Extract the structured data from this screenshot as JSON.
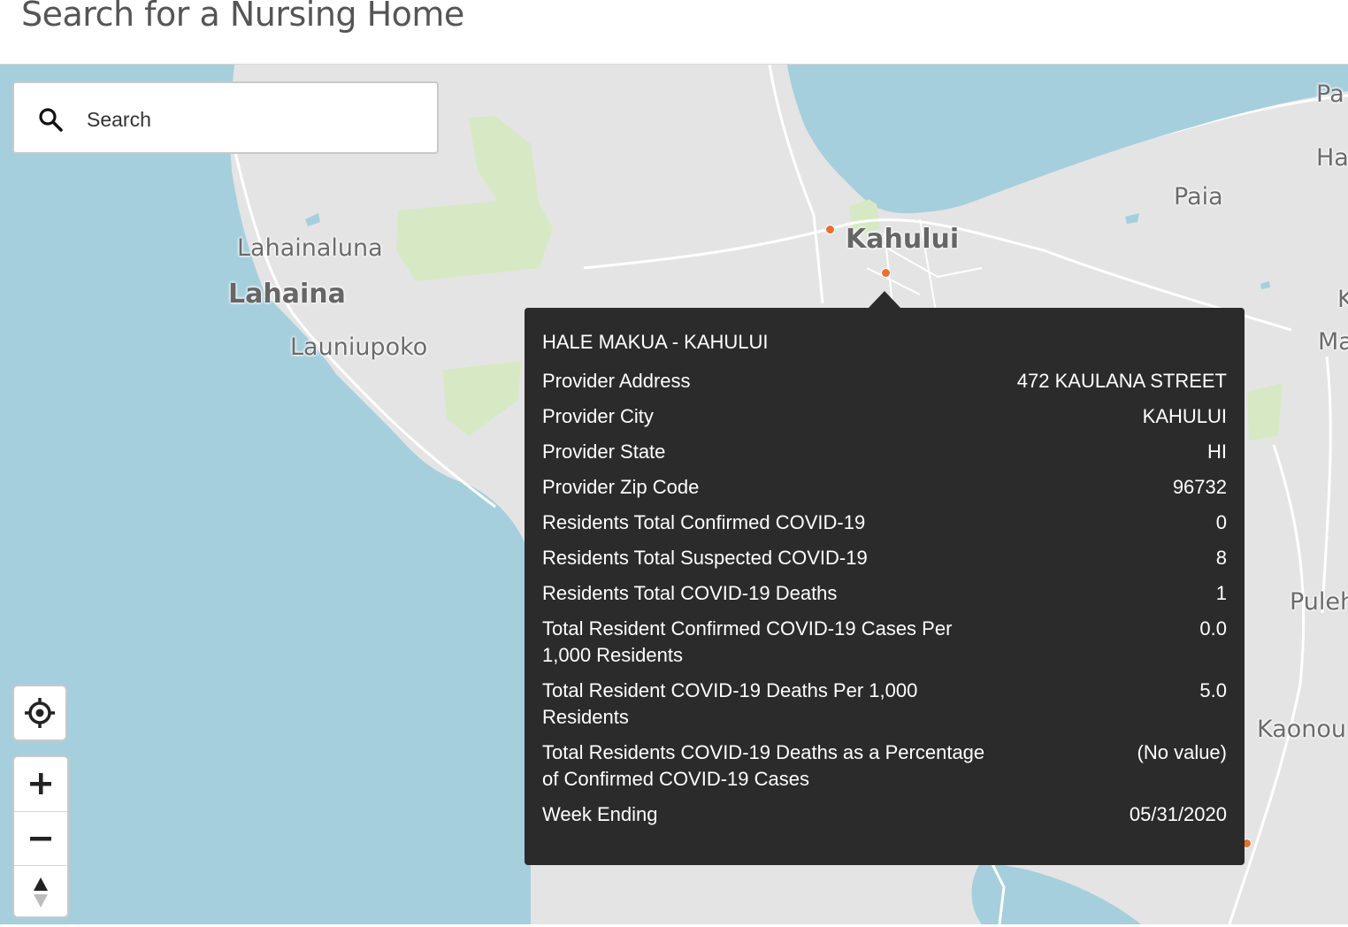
{
  "page": {
    "title": "Search for a Nursing Home"
  },
  "search": {
    "placeholder": "Search"
  },
  "map": {
    "colors": {
      "water": "#a6cfdd",
      "land": "#e4e4e4",
      "park": "#d6e9c4",
      "road": "#ffffff",
      "marker": "#e8712b"
    },
    "place_labels": [
      "Lahainaluna",
      "Lahaina",
      "Launiupoko",
      "Kahului",
      "Paia",
      "Pa",
      "Ha",
      "K",
      "Ma",
      "Puleh",
      "Kaonou"
    ],
    "controls": {
      "locate_icon": "crosshair-icon",
      "zoom_in_icon": "plus-icon",
      "zoom_out_icon": "minus-icon",
      "compass_icon": "compass-icon"
    }
  },
  "popup": {
    "title": "HALE MAKUA - KAHULUI",
    "rows": [
      {
        "label": "Provider Address",
        "value": "472 KAULANA STREET"
      },
      {
        "label": "Provider City",
        "value": "KAHULUI"
      },
      {
        "label": "Provider State",
        "value": "HI"
      },
      {
        "label": "Provider Zip Code",
        "value": "96732"
      },
      {
        "label": "Residents Total Confirmed COVID-19",
        "value": "0"
      },
      {
        "label": "Residents Total Suspected COVID-19",
        "value": "8"
      },
      {
        "label": "Residents Total COVID-19 Deaths",
        "value": "1"
      },
      {
        "label": "Total Resident Confirmed COVID-19 Cases Per 1,000 Residents",
        "value": "0.0"
      },
      {
        "label": "Total Resident COVID-19 Deaths Per 1,000 Residents",
        "value": "5.0"
      },
      {
        "label": "Total Residents COVID-19 Deaths as a Percentage of Confirmed COVID-19 Cases",
        "value": "(No value)"
      },
      {
        "label": "Week Ending",
        "value": "05/31/2020"
      }
    ]
  }
}
